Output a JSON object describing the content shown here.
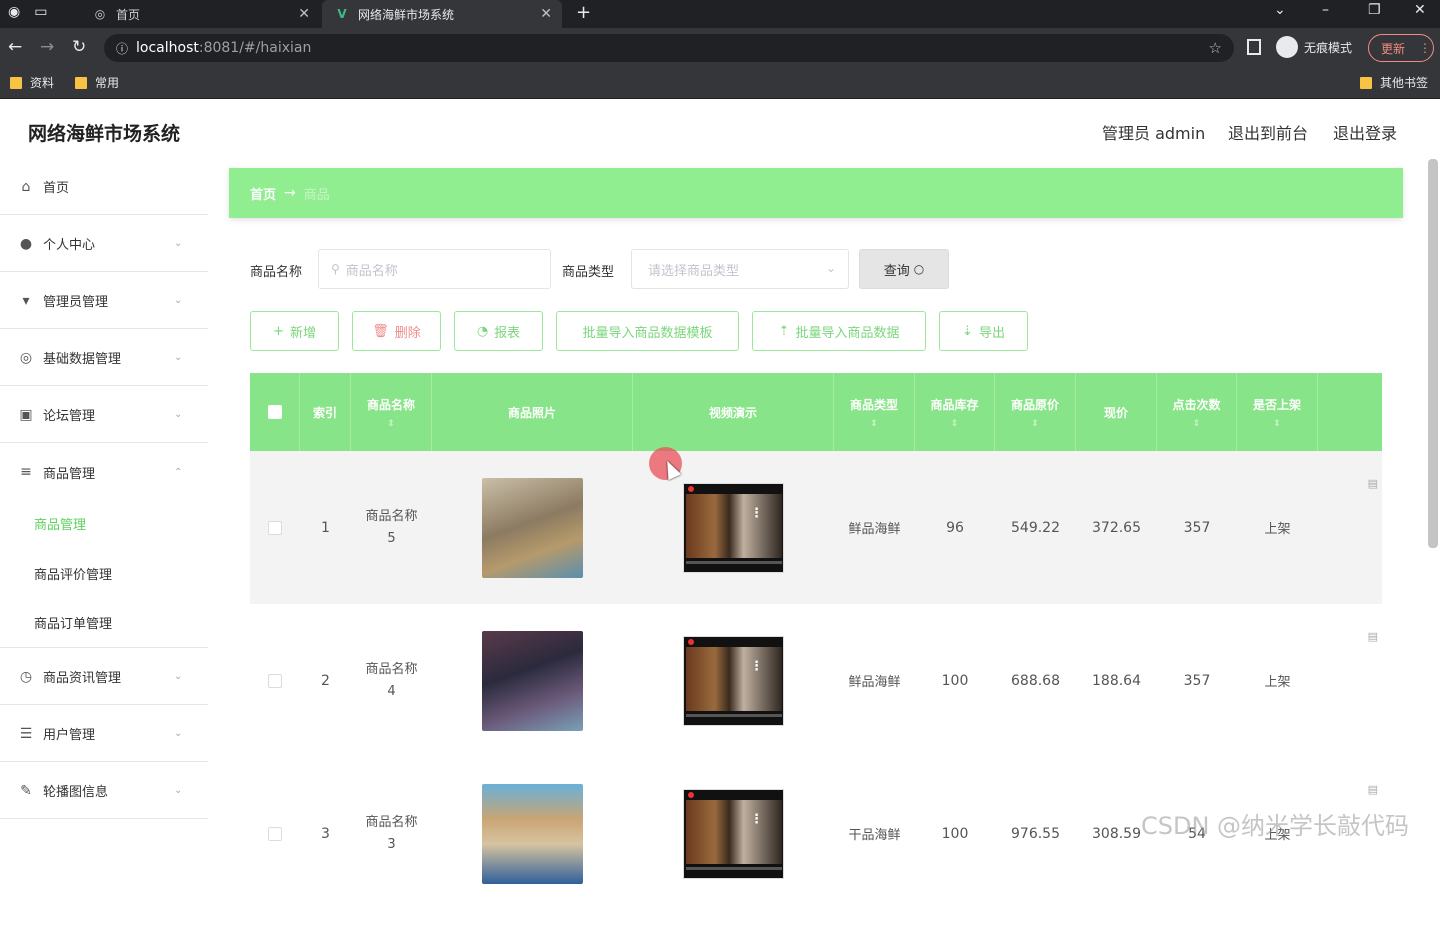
{
  "browser": {
    "tabs": [
      {
        "label": "首页"
      },
      {
        "label": "网络海鲜市场系统"
      }
    ],
    "url_host": "localhost",
    "url_path": ":8081/#/haixian",
    "incognito_label": "无痕模式",
    "update_label": "更新",
    "bookmarks": [
      {
        "label": "资料"
      },
      {
        "label": "常用"
      },
      {
        "label": "其他书签"
      }
    ]
  },
  "app": {
    "title": "网络海鲜市场系统",
    "topnav": {
      "admin": "管理员 admin",
      "front": "退出到前台",
      "logout": "退出登录"
    }
  },
  "sidebar": {
    "items": [
      {
        "label": "首页",
        "icon": "home-icon"
      },
      {
        "label": "个人中心",
        "icon": "user-icon"
      },
      {
        "label": "管理员管理",
        "icon": "pin-icon"
      },
      {
        "label": "基础数据管理",
        "icon": "globe-icon"
      },
      {
        "label": "论坛管理",
        "icon": "clipboard-icon"
      },
      {
        "label": "商品管理",
        "icon": "menu-icon"
      },
      {
        "label": "商品资讯管理",
        "icon": "clock-icon"
      },
      {
        "label": "用户管理",
        "icon": "list-icon"
      },
      {
        "label": "轮播图信息",
        "icon": "pen-icon"
      }
    ],
    "sub_items": [
      {
        "label": "商品管理",
        "active": true
      },
      {
        "label": "商品评价管理",
        "active": false
      },
      {
        "label": "商品订单管理",
        "active": false
      }
    ]
  },
  "breadcrumb": {
    "home": "首页",
    "separator": "→",
    "current": "商品"
  },
  "filters": {
    "name_label": "商品名称",
    "name_placeholder": "商品名称",
    "type_label": "商品类型",
    "type_placeholder": "请选择商品类型",
    "query_label": "查询"
  },
  "actions": {
    "add": "新增",
    "delete": "删除",
    "report": "报表",
    "template": "批量导入商品数据模板",
    "import": "批量导入商品数据",
    "export": "导出"
  },
  "table": {
    "headers": [
      "索引",
      "商品名称",
      "商品照片",
      "视频演示",
      "商品类型",
      "商品库存",
      "商品原价",
      "现价",
      "点击次数",
      "是否上架"
    ],
    "rows": [
      {
        "index": "1",
        "name": "商品名称5",
        "type": "鲜品海鲜",
        "stock": "96",
        "orig_price": "549.22",
        "price": "372.65",
        "clicks": "357",
        "status": "上架"
      },
      {
        "index": "2",
        "name": "商品名称4",
        "type": "鲜品海鲜",
        "stock": "100",
        "orig_price": "688.68",
        "price": "188.64",
        "clicks": "357",
        "status": "上架"
      },
      {
        "index": "3",
        "name": "商品名称3",
        "type": "干品海鲜",
        "stock": "100",
        "orig_price": "976.55",
        "price": "308.59",
        "clicks": "54",
        "status": "上架"
      }
    ]
  },
  "watermark": "CSDN @纳米学长敲代码",
  "colors": {
    "accent": "#90ee90",
    "header_green": "#88e488",
    "delete_red": "#f08c8c"
  }
}
